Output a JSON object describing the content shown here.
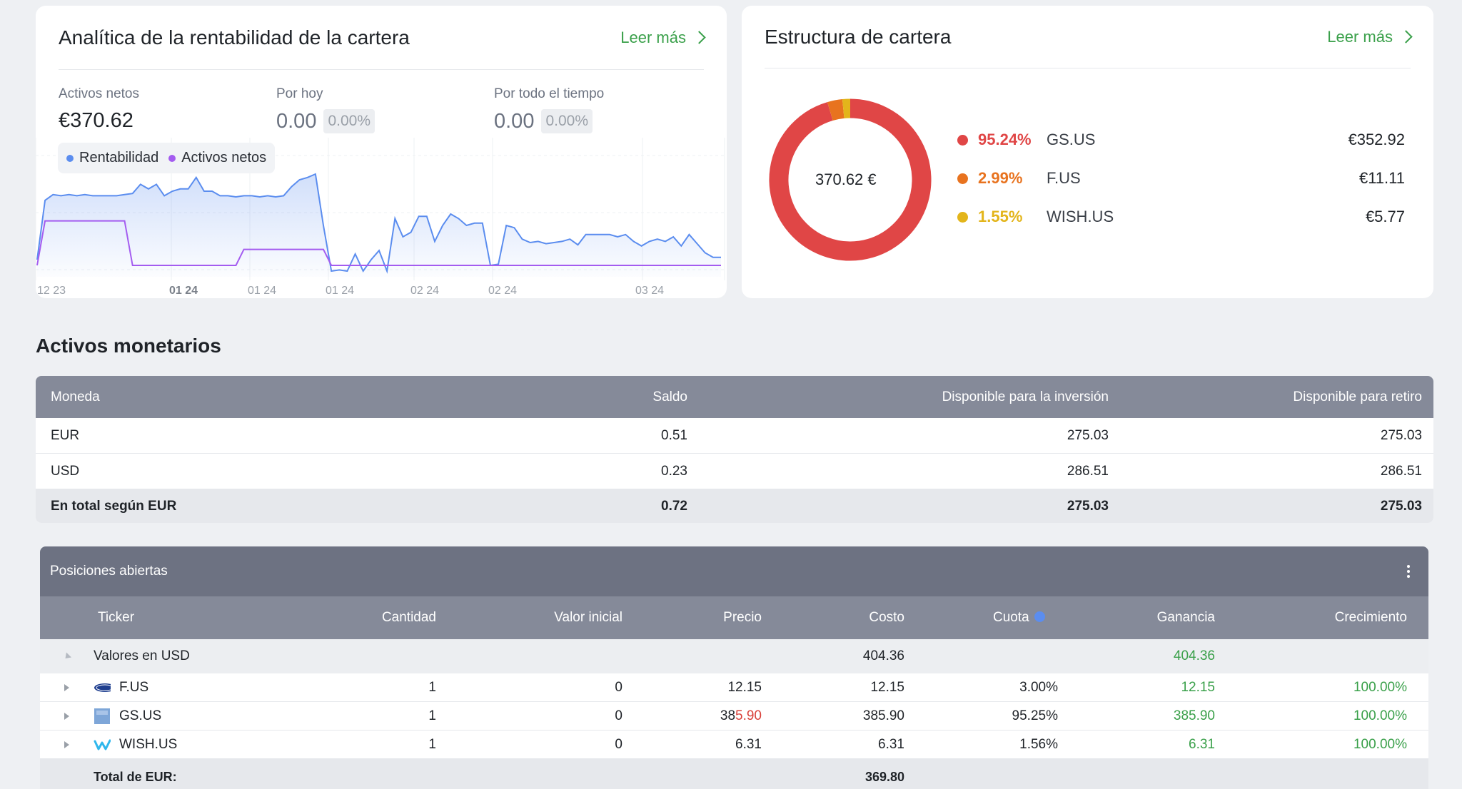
{
  "colors": {
    "accent_green": "#3aa04a",
    "profit_line": "#5b8def",
    "net_assets_line": "#a45cf0",
    "gs_us": "#e04646",
    "f_us": "#e8731f",
    "wish_us": "#e3b51b",
    "table_header": "#858a99"
  },
  "analytics": {
    "title": "Analítica de la rentabilidad de la cartera",
    "read_more": "Leer más",
    "metrics": {
      "net_assets": {
        "label": "Activos netos",
        "value": "€370.62"
      },
      "today": {
        "label": "Por hoy",
        "value": "0.00",
        "pct": "0.00%"
      },
      "all_time": {
        "label": "Por todo el tiempo",
        "value": "0.00",
        "pct": "0.00%"
      }
    },
    "legend": {
      "profit": "Rentabilidad",
      "net_assets": "Activos netos"
    }
  },
  "chart_data": {
    "type": "area",
    "x_tick_labels": [
      "12 23",
      "01 24",
      "01 24",
      "01 24",
      "02 24",
      "02 24",
      "03 24"
    ],
    "legend_placement": "top-left",
    "grid": true,
    "series": [
      {
        "name": "Rentabilidad",
        "color": "#5b8def",
        "values": [
          10,
          62,
          67,
          66,
          67,
          66,
          67,
          66,
          66,
          66,
          66,
          67,
          68,
          76,
          72,
          76,
          66,
          70,
          72,
          72,
          82,
          70,
          70,
          66,
          66,
          65,
          66,
          66,
          65,
          66,
          65,
          66,
          74,
          80,
          82,
          85,
          40,
          0,
          1,
          0,
          15,
          0,
          10,
          18,
          0,
          46,
          30,
          34,
          48,
          48,
          26,
          40,
          50,
          46,
          40,
          42,
          42,
          5,
          6,
          40,
          38,
          28,
          25,
          26,
          24,
          25,
          26,
          28,
          23,
          32,
          32,
          32,
          32,
          30,
          32,
          26,
          22,
          26,
          28,
          26,
          30,
          22,
          32,
          24,
          16,
          12,
          12
        ]
      },
      {
        "name": "Activos netos",
        "color": "#a45cf0",
        "values": [
          5,
          44,
          44,
          44,
          44,
          44,
          44,
          44,
          44,
          44,
          44,
          44,
          5,
          5,
          5,
          5,
          5,
          5,
          5,
          5,
          5,
          5,
          5,
          5,
          5,
          5,
          19,
          19,
          19,
          19,
          19,
          19,
          19,
          19,
          19,
          19,
          19,
          5,
          5,
          5,
          5,
          5,
          5,
          5,
          5,
          5,
          5,
          5,
          5,
          5,
          5,
          5,
          5,
          5,
          5,
          5,
          5,
          5,
          5,
          5,
          5,
          5,
          5,
          5,
          5,
          5,
          5,
          5,
          5,
          5,
          5,
          5,
          5,
          5,
          5,
          5,
          5,
          5,
          5,
          5,
          5,
          5,
          5,
          5,
          5,
          5,
          5
        ]
      }
    ]
  },
  "structure": {
    "title": "Estructura de cartera",
    "read_more": "Leer más",
    "center_label": "370.62 €",
    "donut": {
      "type": "pie",
      "slices": [
        {
          "ticker": "GS.US",
          "pct_value": 95.24,
          "pct": "95.24%",
          "value": "€352.92",
          "color": "#e04646"
        },
        {
          "ticker": "F.US",
          "pct_value": 2.99,
          "pct": "2.99%",
          "value": "€11.11",
          "color": "#e8731f"
        },
        {
          "ticker": "WISH.US",
          "pct_value": 1.55,
          "pct": "1.55%",
          "value": "€5.77",
          "color": "#e3b51b"
        }
      ]
    }
  },
  "money": {
    "title": "Activos monetarios",
    "headers": [
      "Moneda",
      "Saldo",
      "Disponible para la inversión",
      "Disponible para retiro"
    ],
    "rows": [
      [
        "EUR",
        "0.51",
        "275.03",
        "275.03"
      ],
      [
        "USD",
        "0.23",
        "286.51",
        "286.51"
      ]
    ],
    "total": [
      "En total según EUR",
      "0.72",
      "275.03",
      "275.03"
    ]
  },
  "positions": {
    "title": "Posiciones abiertas",
    "headers": [
      "Ticker",
      "Cantidad",
      "Valor inicial",
      "Precio",
      "Costo",
      "Cuota",
      "Ganancia",
      "Crecimiento"
    ],
    "group": {
      "label": "Valores en USD",
      "cost": "404.36",
      "gain": "404.36"
    },
    "rows": [
      {
        "ticker": "F.US",
        "icon": "ford-logo-icon",
        "qty": "1",
        "initial": "0",
        "price": "12.15",
        "price_a": "12.15",
        "price_b": "",
        "cost": "12.15",
        "share": "3.00%",
        "gain": "12.15",
        "growth": "100.00%"
      },
      {
        "ticker": "GS.US",
        "icon": "goldman-sachs-logo-icon",
        "qty": "1",
        "initial": "0",
        "price": "385.90",
        "price_a": "38",
        "price_b": "5.90",
        "cost": "385.90",
        "share": "95.25%",
        "gain": "385.90",
        "growth": "100.00%"
      },
      {
        "ticker": "WISH.US",
        "icon": "wish-logo-icon",
        "qty": "1",
        "initial": "0",
        "price": "6.31",
        "price_a": "6.31",
        "price_b": "",
        "cost": "6.31",
        "share": "1.56%",
        "gain": "6.31",
        "growth": "100.00%"
      }
    ],
    "footer": {
      "label": "Total de EUR:",
      "cost": "369.80"
    }
  }
}
